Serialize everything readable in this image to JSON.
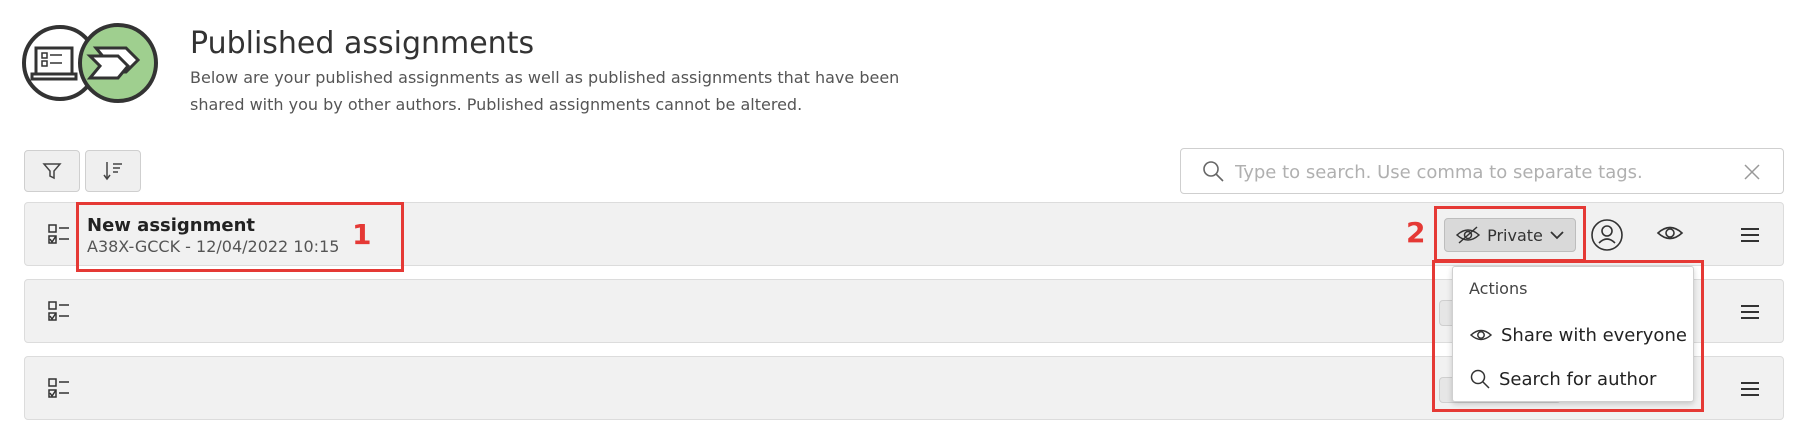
{
  "header": {
    "title": "Published assignments",
    "description": "Below are your published assignments as well as published assignments that have been shared with you by other authors. Published assignments cannot be altered."
  },
  "toolbar": {
    "filter_icon": "filter-icon",
    "sort_icon": "sort-icon"
  },
  "search": {
    "placeholder": "Type to search. Use comma to separate tags.",
    "value": ""
  },
  "assignments": [
    {
      "title": "New assignment",
      "meta": "A38X-GCCK - 12/04/2022 10:15",
      "visibility": "Private"
    },
    {
      "title": "",
      "meta": ""
    },
    {
      "title": "",
      "meta": ""
    }
  ],
  "dropdown": {
    "heading": "Actions",
    "items": [
      {
        "label": "Share with everyone",
        "icon": "eye-icon"
      },
      {
        "label": "Search for author",
        "icon": "search-icon"
      }
    ]
  },
  "callouts": {
    "one": "1",
    "two": "2"
  },
  "colors": {
    "accent_green": "#9fcf8f",
    "callout_red": "#e53935",
    "row_bg": "#f1f1f1"
  }
}
